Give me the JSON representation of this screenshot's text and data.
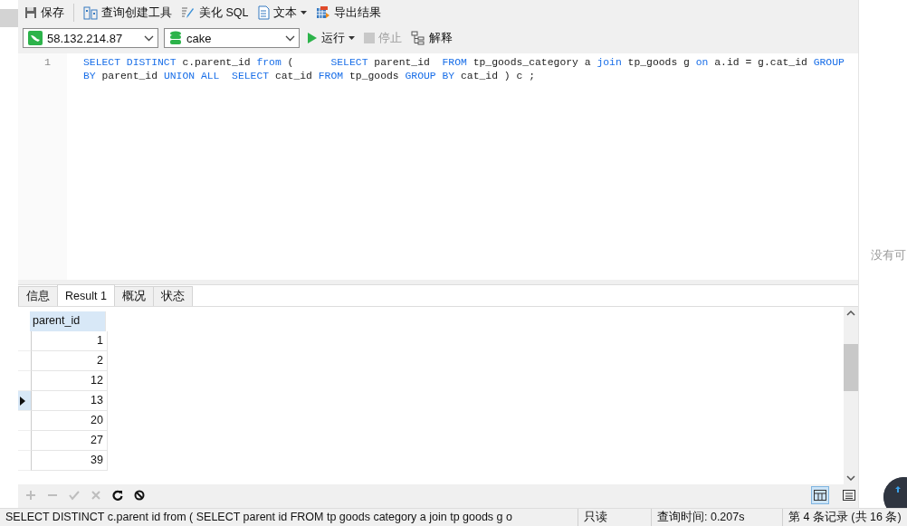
{
  "toolbar": {
    "items": [
      {
        "label": "保存",
        "kind": "save"
      },
      {
        "label": "查询创建工具",
        "kind": "builder"
      },
      {
        "label": "美化 SQL",
        "kind": "beautify"
      },
      {
        "label": "文本",
        "kind": "text",
        "dropdown": true
      },
      {
        "label": "导出结果",
        "kind": "export"
      }
    ]
  },
  "connection": {
    "value": "58.132.214.87"
  },
  "database": {
    "value": "cake"
  },
  "actions": [
    {
      "label": "运行",
      "kind": "run",
      "dropdown": true,
      "disabled": false
    },
    {
      "label": "停止",
      "kind": "stop",
      "disabled": true
    },
    {
      "label": "解释",
      "kind": "explain",
      "disabled": false
    }
  ],
  "editor": {
    "line_number": "1",
    "tokens": [
      {
        "text": "SELECT DISTINCT",
        "kind": "keyword"
      },
      {
        "text": " c.parent_id ",
        "kind": "plain"
      },
      {
        "text": "from",
        "kind": "keyword"
      },
      {
        "text": " (      ",
        "kind": "plain"
      },
      {
        "text": "SELECT",
        "kind": "keyword"
      },
      {
        "text": " parent_id  ",
        "kind": "plain"
      },
      {
        "text": "FROM",
        "kind": "keyword"
      },
      {
        "text": " tp_goods_category a ",
        "kind": "plain"
      },
      {
        "text": "join",
        "kind": "keyword"
      },
      {
        "text": " tp_goods g ",
        "kind": "plain"
      },
      {
        "text": "on",
        "kind": "keyword"
      },
      {
        "text": " a.id = g.cat_id ",
        "kind": "plain"
      },
      {
        "text": "GROUP BY",
        "kind": "keyword"
      },
      {
        "text": " parent_id ",
        "kind": "plain"
      },
      {
        "text": "UNION ALL",
        "kind": "keyword"
      },
      {
        "text": "  SELECT",
        "kind": "keyword"
      },
      {
        "text": " cat_id ",
        "kind": "plain"
      },
      {
        "text": "FROM",
        "kind": "keyword"
      },
      {
        "text": " tp_goods ",
        "kind": "plain"
      },
      {
        "text": "GROUP BY",
        "kind": "keyword"
      },
      {
        "text": " cat_id ) c ;",
        "kind": "plain"
      }
    ]
  },
  "result_tabs": [
    {
      "label": "信息",
      "selected": false
    },
    {
      "label": "Result 1",
      "selected": true
    },
    {
      "label": "概况",
      "selected": false
    },
    {
      "label": "状态",
      "selected": false
    }
  ],
  "table": {
    "columns": [
      "parent_id"
    ],
    "rows": [
      {
        "cells": [
          "1"
        ],
        "selected": false
      },
      {
        "cells": [
          "2"
        ],
        "selected": false
      },
      {
        "cells": [
          "12"
        ],
        "selected": false
      },
      {
        "cells": [
          "13"
        ],
        "selected": true
      },
      {
        "cells": [
          "20"
        ],
        "selected": false
      },
      {
        "cells": [
          "27"
        ],
        "selected": false
      },
      {
        "cells": [
          "39"
        ],
        "selected": false
      }
    ]
  },
  "grid_tools": [
    {
      "kind": "add",
      "disabled": true
    },
    {
      "kind": "remove",
      "disabled": true
    },
    {
      "kind": "apply",
      "disabled": true
    },
    {
      "kind": "cancel",
      "disabled": true
    },
    {
      "kind": "refresh",
      "disabled": false
    },
    {
      "kind": "stop",
      "disabled": false
    }
  ],
  "view_modes": [
    {
      "kind": "grid",
      "selected": true
    },
    {
      "kind": "form",
      "selected": false
    }
  ],
  "status_bar": {
    "sql": "SELECT DISTINCT c.parent id from (      SELECT parent id  FROM tp goods category a join tp goods g o",
    "mode": "只读",
    "query_time": "查询时间: 0.207s",
    "record": "第 4 条记录 (共 16 条)"
  },
  "side_panel": {
    "message": "没有可"
  }
}
